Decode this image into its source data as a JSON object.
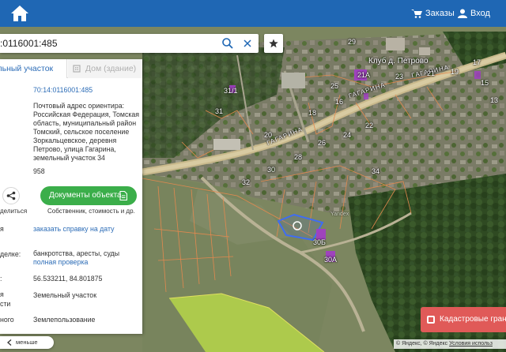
{
  "header": {
    "orders_label": "Заказы",
    "login_label": "Вход"
  },
  "search": {
    "value": ":0116001:485"
  },
  "panel": {
    "tab_land": "ельный участок",
    "tab_building": "Дом (здание)",
    "cadastral_number": "70:14:0116001:485",
    "address": "Почтовый адрес ориентира: Российская Федерация, Томская область, муниципальный район Томский, сельское поселение Зоркальцевское, деревня Петрово, улица Гагарина, земельный участок 34",
    "area": "958",
    "share_label": "делиться",
    "documents_button": "Документы объекта",
    "documents_sub": "Собственник, стоимость и др.",
    "ref_label": "я",
    "ref_link": "заказать справку на дату",
    "check_label": "делке:",
    "check_value": "банкротства, аресты, суды",
    "check_link": "полная проверка",
    "coord_label": ":",
    "coordinates": "56.533211, 84.801875",
    "type_label_1": "я",
    "type_label_2": "сти",
    "type_value": "Земельный участок",
    "use_label": "ного",
    "use_value": "Землепользование"
  },
  "bottom": {
    "less_label": "меньше",
    "cadastral_bounds": "Кадастровые грани",
    "attribution": "© Яндекс, © Яндекс",
    "terms": "Условия использ"
  },
  "map": {
    "club_label": "Клуб д. Петрово",
    "street_1": "ГАГАРИНА",
    "street_2": "ГАГАРИНА",
    "street_3": "ГАГАРИНА",
    "yandex_wm": "Yandex",
    "plot_label": "30Б",
    "houses": [
      "29",
      "31/1",
      "25",
      "23",
      "21",
      "19",
      "17",
      "15",
      "13",
      "22",
      "24",
      "26",
      "28",
      "30",
      "32",
      "20",
      "18",
      "16",
      "30А",
      "21А",
      "34",
      "31"
    ]
  },
  "colors": {
    "header_bg": "#1f67b4",
    "green_button": "#3bae4a",
    "link": "#2d6db7",
    "red_button": "#e05a58"
  }
}
